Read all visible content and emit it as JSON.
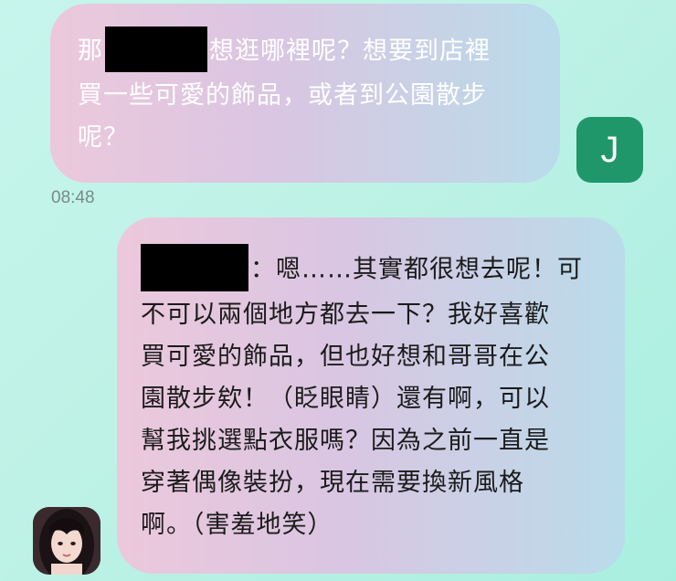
{
  "messages": {
    "outgoing": {
      "line1_prefix": "那",
      "line1_suffix": "想逛哪裡呢？想要到店裡",
      "line2": "買一些可愛的飾品，或者到公園散步",
      "line3": "呢？",
      "time": "08:48",
      "avatar_initial": "J"
    },
    "incoming": {
      "line1_suffix": "：嗯……其實都很想去呢！可",
      "line2": "不可以兩個地方都去一下？我好喜歡",
      "line3": "買可愛的飾品，但也好想和哥哥在公",
      "line4": "園散步欸！（眨眼睛）還有啊，可以",
      "line5": "幫我挑選點衣服嗎？因為之前一直是",
      "line6": "穿著偶像裝扮，現在需要換新風格",
      "line7": "啊。（害羞地笑）"
    }
  },
  "colors": {
    "avatar_j": "#20976a",
    "redaction": "#000000"
  },
  "icons": {
    "avatar_incoming": "girl-portrait-avatar-icon"
  }
}
